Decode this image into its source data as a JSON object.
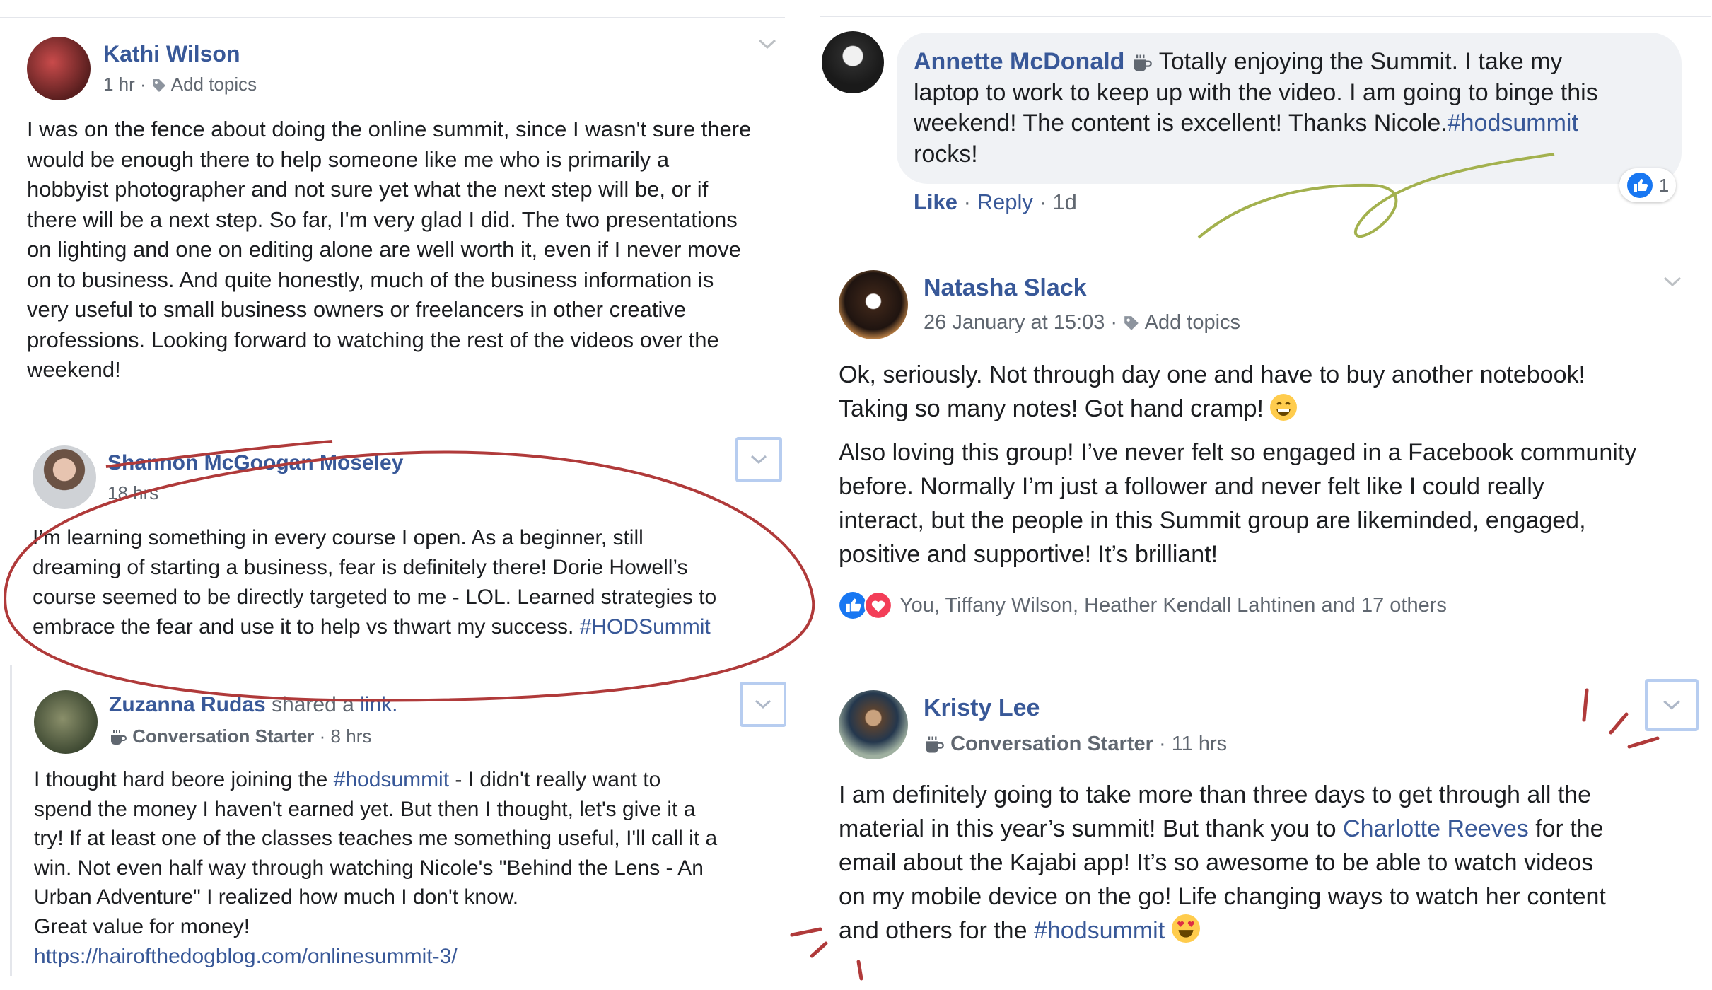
{
  "left_column": {
    "post1": {
      "author": "Kathi Wilson",
      "time": "1 hr",
      "add_topics": "Add topics",
      "lines": [
        "I was on the fence about doing the online summit, since I wasn't sure there",
        "would be enough there to help someone like me who is primarily a",
        "hobbyist photographer and not sure yet what the next step will be, or if",
        "there will be a next step. So far, I'm very glad I did. The two presentations",
        "on lighting and one on editing alone are well worth it, even if I never move",
        "on to business. And quite honestly, much of the business information is",
        "very useful to small business owners or freelancers in other creative",
        "professions. Looking forward to watching the rest of the videos over the",
        "weekend!"
      ]
    },
    "post2": {
      "author": "Shannon McGoogan Moseley",
      "time": "18 hrs",
      "lines": [
        "I’m learning something in every course I open. As a beginner, still",
        "dreaming of starting a business, fear is definitely there! Dorie Howell’s",
        "course seemed to be directly targeted to me - LOL. Learned strategies to",
        "embrace the fear and use it to help vs thwart my success."
      ],
      "hashtag": "#HODSummit"
    },
    "post3": {
      "author": "Zuzanna Rudas",
      "shared": "shared a",
      "shared_link": "link.",
      "badge": "Conversation Starter",
      "time": "8 hrs",
      "line1_a": "I thought hard beore joining the",
      "line1_tag": "#hodsummit",
      "line1_b": "- I didn't really want to",
      "lines": [
        "spend the money I haven't earned yet. But then I thought, let's give it a",
        "try! If at least one of the classes teaches me something useful, I'll call it a",
        "win. Not even half way through watching Nicole's \"Behind the Lens - An",
        "Urban Adventure\" I realized how much I don't know.",
        "Great value for money!"
      ],
      "url": "https://hairofthedogblog.com/onlinesummit-3/"
    }
  },
  "right_column": {
    "comment": {
      "author": "Annette McDonald",
      "line1": "Totally enjoying the Summit. I take my",
      "line2": "laptop to work to keep up with the video. I am going to binge this",
      "line3_a": "weekend! The content is excellent! Thanks Nicole.",
      "line3_tag": "#hodsummit",
      "line4": "rocks!",
      "like": "Like",
      "reply": "Reply",
      "age": "1d",
      "like_count": "1"
    },
    "post4": {
      "author": "Natasha Slack",
      "time": "26 January at 15:03",
      "add_topics": "Add topics",
      "para1_line1": "Ok, seriously. Not through day one and have to buy another notebook!",
      "para1_line2": "Taking so many notes! Got hand cramp!",
      "para2": [
        "Also loving this group! I’ve never felt so engaged in a Facebook community",
        "before. Normally I’m just a follower and never felt like I could really",
        "interact, but the people in this Summit group are likeminded, engaged,",
        "positive and supportive! It’s brilliant!"
      ],
      "reactions": "You, Tiffany Wilson, Heather Kendall Lahtinen and 17 others"
    },
    "post5": {
      "author": "Kristy Lee",
      "badge": "Conversation Starter",
      "time": "11 hrs",
      "line1": "I am definitely going to take more than three days to get through all the",
      "line2_a": "material in this year’s summit! But thank you to",
      "line2_link": "Charlotte Reeves",
      "line2_b": "for the",
      "line3": "email about the Kajabi app! It’s so awesome to be able to watch videos",
      "line4": "on my mobile device on the go! Life changing ways to watch her content",
      "line5_a": "and others for the",
      "line5_tag": "#hodsummit"
    }
  },
  "colors": {
    "link": "#385898",
    "meta": "#606770",
    "annotation_red": "#b03a3a",
    "annotation_green": "#a3b14e",
    "button_border": "#b7cdf0"
  }
}
